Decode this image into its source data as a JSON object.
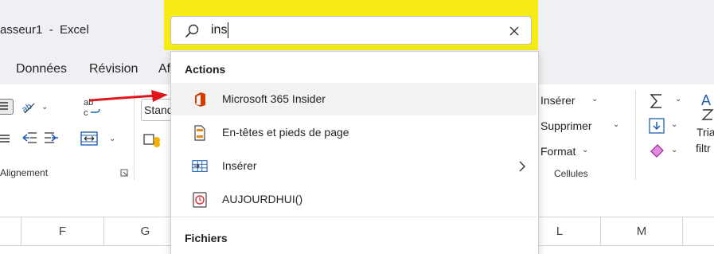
{
  "window": {
    "title": "asseur1  -  Excel"
  },
  "menu": {
    "items": [
      "Données",
      "Révision",
      "Af"
    ]
  },
  "ribbon": {
    "alignment_label": "Alignement",
    "style_box": "Stand",
    "cells": {
      "insert": "Insérer",
      "delete": "Supprimer",
      "format": "Format",
      "label": "Cellules"
    },
    "editing": {
      "sort": "Tria",
      "filter": "filtr",
      "sort_letters": "A"
    }
  },
  "columns": [
    "F",
    "G",
    "",
    "",
    "",
    "",
    "L",
    "M"
  ],
  "search": {
    "value": "ins"
  },
  "dropdown": {
    "actions_title": "Actions",
    "actions": [
      {
        "label": "Microsoft 365 Insider",
        "icon": "office-logo-icon"
      },
      {
        "label": "En-têtes et pieds de page",
        "icon": "header-footer-icon"
      },
      {
        "label": "Insérer",
        "icon": "insert-table-icon",
        "has_submenu": true
      },
      {
        "label": "AUJOURDHUI()",
        "icon": "function-clock-icon"
      }
    ],
    "files_title": "Fichiers"
  },
  "colors": {
    "highlight": "#f6ec14",
    "arrow": "#e0151b",
    "office_red": "#d83b01",
    "icon_blue": "#1e5fb4"
  }
}
